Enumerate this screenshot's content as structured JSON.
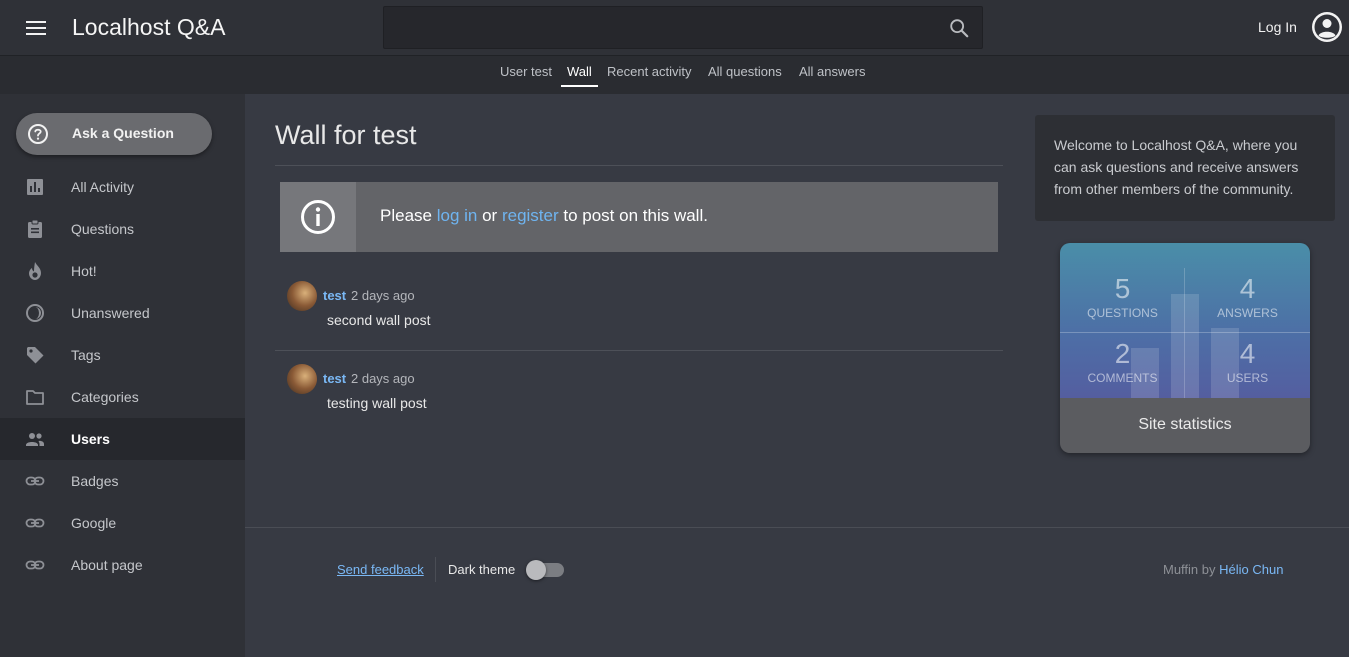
{
  "header": {
    "menu_icon": "hamburger-menu-icon",
    "title": "Localhost Q&A",
    "search": {
      "placeholder": "",
      "value": "",
      "icon": "search-icon"
    },
    "login_label": "Log In",
    "user_icon": "account-circle-icon"
  },
  "subnav": {
    "tabs": [
      {
        "label": "User test",
        "active": false
      },
      {
        "label": "Wall",
        "active": true
      },
      {
        "label": "Recent activity",
        "active": false
      },
      {
        "label": "All questions",
        "active": false
      },
      {
        "label": "All answers",
        "active": false
      }
    ]
  },
  "sidebar": {
    "ask_button": {
      "label": "Ask a Question",
      "icon": "help-circle-icon"
    },
    "items": [
      {
        "label": "All Activity",
        "icon": "bar-chart-icon",
        "active": false
      },
      {
        "label": "Questions",
        "icon": "clipboard-icon",
        "active": false
      },
      {
        "label": "Hot!",
        "icon": "flame-icon",
        "active": false
      },
      {
        "label": "Unanswered",
        "icon": "half-moon-icon",
        "active": false
      },
      {
        "label": "Tags",
        "icon": "tag-icon",
        "active": false
      },
      {
        "label": "Categories",
        "icon": "folder-icon",
        "active": false
      },
      {
        "label": "Users",
        "icon": "people-icon",
        "active": true
      },
      {
        "label": "Badges",
        "icon": "link-icon",
        "active": false
      },
      {
        "label": "Google",
        "icon": "link-icon",
        "active": false
      },
      {
        "label": "About page",
        "icon": "link-icon",
        "active": false
      }
    ]
  },
  "main": {
    "title": "Wall for test",
    "notice": {
      "icon": "info-icon",
      "prefix": "Please",
      "login_link": "log in",
      "middle": "or",
      "register_link": "register",
      "suffix": "to post on this wall."
    },
    "posts": [
      {
        "author": "test",
        "time": "2 days ago",
        "body": "second wall post"
      },
      {
        "author": "test",
        "time": "2 days ago",
        "body": "testing wall post"
      }
    ]
  },
  "right": {
    "welcome": "Welcome to Localhost Q&A, where you can ask questions and receive answers from other members of the community.",
    "stats": {
      "questions": {
        "value": "5",
        "label": "QUESTIONS"
      },
      "answers": {
        "value": "4",
        "label": "ANSWERS"
      },
      "comments": {
        "value": "2",
        "label": "COMMENTS"
      },
      "users": {
        "value": "4",
        "label": "USERS"
      },
      "footer_label": "Site statistics"
    }
  },
  "footer": {
    "feedback": "Send feedback",
    "dark_theme_label": "Dark theme",
    "dark_theme_on": false,
    "credit_prefix": "Muffin by",
    "credit_author": "Hélio Chun"
  }
}
